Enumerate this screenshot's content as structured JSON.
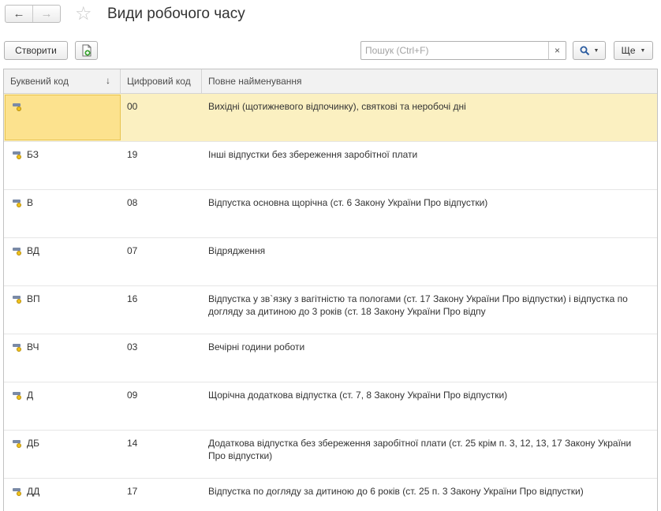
{
  "window": {
    "title": "Види робочого часу"
  },
  "toolbar": {
    "create_label": "Створити",
    "search_placeholder": "Пошук (Ctrl+F)",
    "clear_label": "×",
    "more_label": "Ще"
  },
  "table": {
    "columns": [
      "Буквений код",
      "Цифровий код",
      "Повне найменування"
    ],
    "sort_indicator": "↓",
    "rows": [
      {
        "letter": "",
        "digit": "00",
        "name": "Вихідні (щотижневого відпочинку), святкові та неробочі дні"
      },
      {
        "letter": "БЗ",
        "digit": "19",
        "name": "Інші відпустки без збереження заробітної плати"
      },
      {
        "letter": "В",
        "digit": "08",
        "name": "Відпустка основна щорічна (ст. 6 Закону України Про відпустки)"
      },
      {
        "letter": "ВД",
        "digit": "07",
        "name": "Відрядження"
      },
      {
        "letter": "ВП",
        "digit": "16",
        "name": "Відпустка у зв`язку з вагітністю та пологами (ст. 17 Закону України Про відпустки) і відпустка по догляду за дитиною до 3 років (ст. 18 Закону України Про відпу"
      },
      {
        "letter": "ВЧ",
        "digit": "03",
        "name": "Вечірні години роботи"
      },
      {
        "letter": "Д",
        "digit": "09",
        "name": "Щорічна додаткова відпустка (ст. 7, 8 Закону України Про відпустки)"
      },
      {
        "letter": "ДБ",
        "digit": "14",
        "name": "Додаткова відпустка без збереження заробітної плати (ст. 25 крім п. 3, 12, 13, 17 Закону України Про відпустки)"
      },
      {
        "letter": "ДД",
        "digit": "17",
        "name": "Відпустка по догляду за дитиною до 6 років (ст. 25 п. 3 Закону України Про відпустки)"
      }
    ]
  },
  "colors": {
    "selected_row": "#fbf0c1",
    "selected_cell": "#fce28e",
    "header_bg": "#f2f2f2"
  },
  "icons": {
    "back": "arrow-left-icon",
    "forward": "arrow-right-icon",
    "favorite": "star-icon",
    "copy": "document-plus-icon",
    "search": "magnifier-icon",
    "row": "item-marker-icon"
  }
}
